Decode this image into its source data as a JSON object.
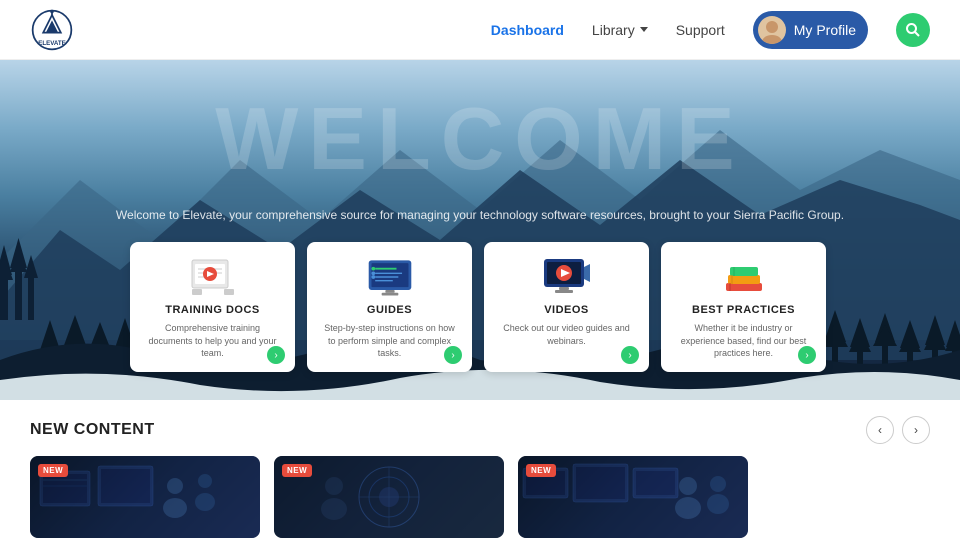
{
  "header": {
    "logo_text": "ELEVATE",
    "nav": {
      "dashboard": "Dashboard",
      "library": "Library",
      "support": "Support"
    },
    "profile_label": "My Profile",
    "search_label": "Search"
  },
  "hero": {
    "welcome_text": "WELCOME",
    "subtitle": "Welcome to Elevate, your comprehensive source for managing your technology software resources, brought to your Sierra Pacific Group."
  },
  "cards": [
    {
      "id": "training-docs",
      "title": "TRAINING DOCS",
      "description": "Comprehensive training documents to help you and your team."
    },
    {
      "id": "guides",
      "title": "GUIDES",
      "description": "Step-by-step instructions on how to perform simple and complex tasks."
    },
    {
      "id": "videos",
      "title": "VIDEOS",
      "description": "Check out our video guides and webinars."
    },
    {
      "id": "best-practices",
      "title": "BEST PRACTICES",
      "description": "Whether it be industry or experience based, find our best practices here."
    }
  ],
  "new_content": {
    "title": "NEW CONTENT",
    "prev_label": "‹",
    "next_label": "›",
    "badge_label": "NEW",
    "items": [
      {
        "id": "content-1",
        "badge": "NEW"
      },
      {
        "id": "content-2",
        "badge": "NEW"
      },
      {
        "id": "content-3",
        "badge": "NEW"
      }
    ]
  },
  "colors": {
    "accent_green": "#2ecc71",
    "accent_blue": "#2a5aa7",
    "accent_red": "#e74c3c"
  }
}
